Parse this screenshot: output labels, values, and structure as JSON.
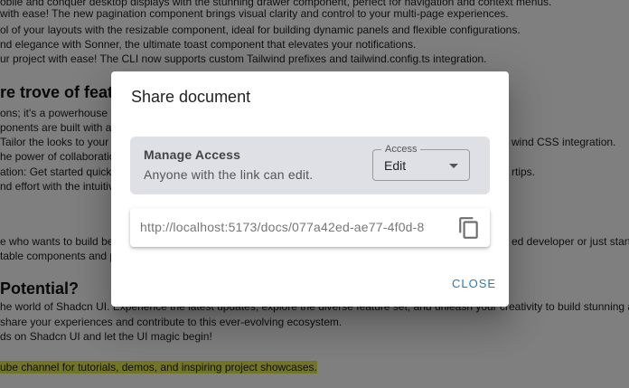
{
  "background": {
    "lines": [
      "obile and conquer desktop displays with the stunning drawer component, perfect for navigation and context menus.",
      "with ease! The new pagination component brings visual clarity and control to your multi-page experiences.",
      "ol of your layouts with the resizable component, ideal for building dynamic panels and flexible configurations.",
      "nd elegance with Sonner, the ultimate toast component that elevates your notifications.",
      "ur project with ease! The CLI now supports custom Tailwind prefixes and tailwind.config.ts integration.",
      "ons; it's a powerhouse p",
      "ponents are built with ac",
      "Tailor the looks to your h",
      "he power of collaboratio",
      "ation: Get started quickl",
      "nd effort with the intuitiv",
      "e who wants to build bea",
      "table components and p",
      "he world of Shadcn UI. Experience the latest updates, explore the diverse feature set, and unleash your creativity to build stunning and",
      "share your experiences and contribute to this ever-evolving ecosystem.",
      "ds on Shadcn UI and let the UI magic begin!",
      "ube channel for tutorials, demos, and inspiring project showcases."
    ],
    "right_fragments": [
      "wind CSS integration.",
      "rtips.",
      "ed developer or just startin"
    ],
    "headings": [
      "re trove of feat",
      "Potential?"
    ]
  },
  "dialog": {
    "title": "Share document",
    "manage_access": {
      "title": "Manage Access",
      "description": "Anyone with the link can edit.",
      "select": {
        "label": "Access",
        "value": "Edit"
      }
    },
    "link": {
      "url": "http://localhost:5173/docs/077a42ed-ae77-4f0d-8"
    },
    "close_label": "CLOSE"
  },
  "colors": {
    "overlay": "#000000",
    "panel_bg": "#dfdfe6",
    "accent": "#2a7ab8",
    "highlight": "#e6ea4c"
  },
  "icons": {
    "copy": "copy-icon",
    "dropdown": "arrow-drop-down-icon"
  }
}
